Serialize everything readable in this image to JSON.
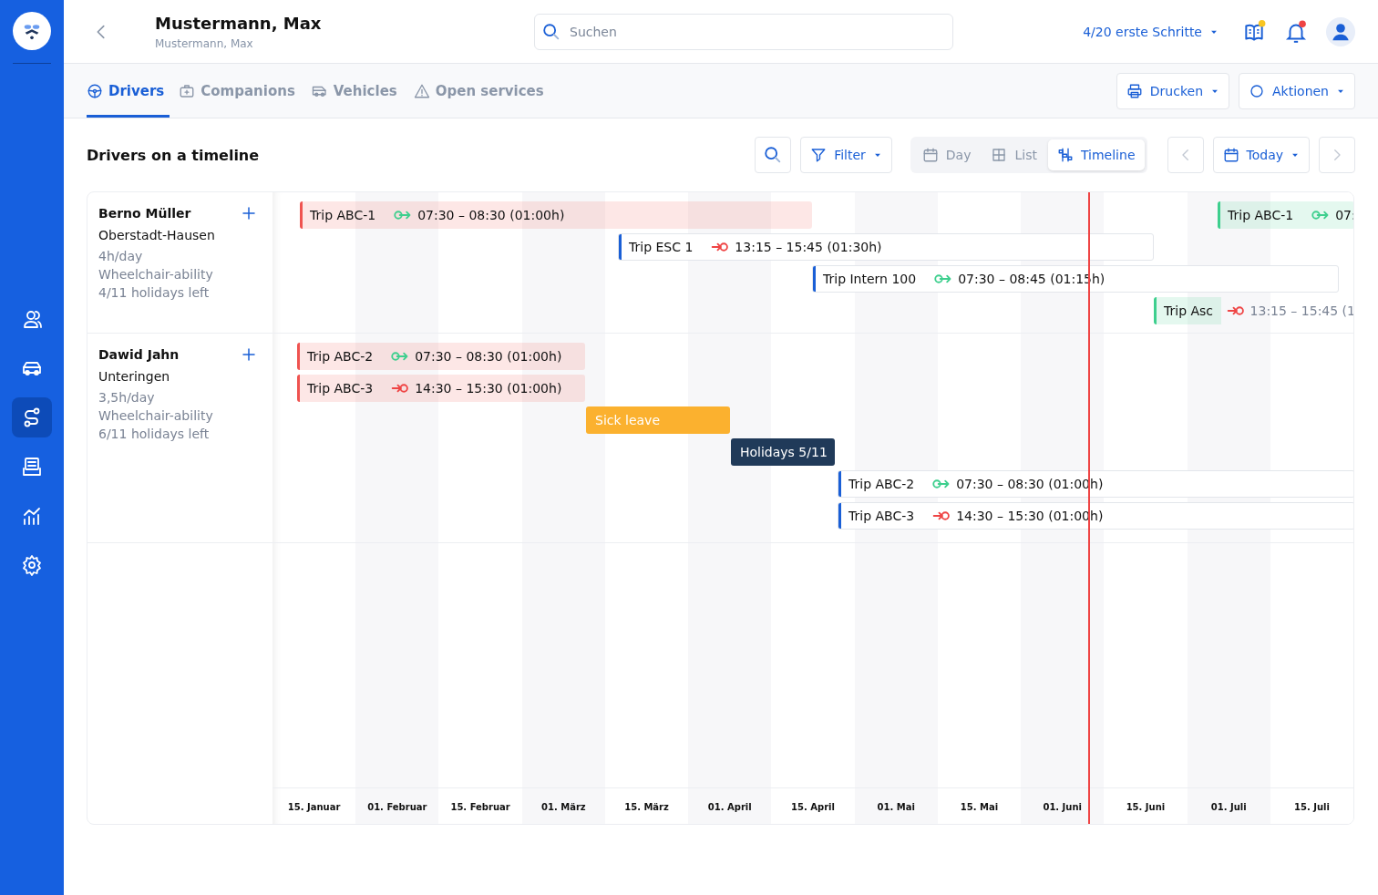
{
  "sidebar": {
    "items": [
      {
        "kind": "people",
        "selected": false
      },
      {
        "kind": "car",
        "selected": false
      },
      {
        "kind": "route",
        "selected": true
      },
      {
        "kind": "inbox",
        "selected": false
      },
      {
        "kind": "stats",
        "selected": false
      },
      {
        "kind": "settings",
        "selected": false
      }
    ]
  },
  "header": {
    "title": "Mustermann, Max",
    "subtitle": "Mustermann, Max",
    "search": {
      "placeholder": "Suchen"
    },
    "onboarding": "4/20 erste Schritte"
  },
  "tabs": [
    {
      "label": "Drivers",
      "kind": "steering",
      "selected": true
    },
    {
      "label": "Companions",
      "kind": "medkit",
      "selected": false
    },
    {
      "label": "Vehicles",
      "kind": "van",
      "selected": false
    },
    {
      "label": "Open services",
      "kind": "warning",
      "selected": false
    }
  ],
  "actions": [
    {
      "label": "Drucken",
      "kind": "printer"
    },
    {
      "label": "Aktionen",
      "kind": "circle"
    }
  ],
  "section_title": "Drivers on a timeline",
  "toolbar": {
    "filter": "Filter",
    "views": [
      {
        "label": "Day",
        "kind": "calendar",
        "selected": false
      },
      {
        "label": "List",
        "kind": "grid",
        "selected": false
      },
      {
        "label": "Timeline",
        "kind": "timeline",
        "selected": true
      }
    ],
    "today": "Today"
  },
  "drivers": [
    {
      "name": "Berno Müller",
      "city": "Oberstadt-Hausen",
      "details": [
        "4h/day",
        "Wheelchair-ability",
        "4/11 holidays left"
      ],
      "bars": [
        {
          "kind": "trip",
          "title": "Trip ABC-1",
          "color": "#ef5350",
          "filled": true,
          "outbound": true,
          "time": "07:30 – 08:30 (01:00h)"
        },
        {
          "kind": "trip",
          "title": "Trip ABC-1",
          "color": "#3ecf8e",
          "filled": true,
          "outbound": true,
          "time": "07:"
        },
        {
          "kind": "trip",
          "title": "Trip ESC 1",
          "color": "#1a5fd6",
          "filled": false,
          "outbound": false,
          "time": "13:15 – 15:45 (01:30h)"
        },
        {
          "kind": "trip",
          "title": "Trip Intern 100",
          "color": "#1a5fd6",
          "filled": false,
          "outbound": true,
          "time": "07:30 – 08:45 (01:15h)"
        },
        {
          "kind": "trip",
          "title": "Trip Asc",
          "color": "#3ecf8e",
          "filled": true,
          "outbound": false,
          "time": "13:15 – 15:45 (1"
        }
      ]
    },
    {
      "name": "Dawid Jahn",
      "city": "Unteringen",
      "details": [
        "3,5h/day",
        "Wheelchair-ability",
        "6/11 holidays left"
      ],
      "bars": [
        {
          "kind": "trip",
          "title": "Trip ABC-2",
          "color": "#ef5350",
          "filled": true,
          "outbound": true,
          "time": "07:30 – 08:30 (01:00h)"
        },
        {
          "kind": "trip",
          "title": "Trip ABC-3",
          "color": "#ef5350",
          "filled": true,
          "outbound": false,
          "time": "14:30 – 15:30 (01:00h)"
        },
        {
          "kind": "absence",
          "title": "Sick leave",
          "color": "#fbb12f"
        },
        {
          "kind": "absence",
          "title": "Holidays 5/11",
          "color": "#203a59"
        },
        {
          "kind": "trip",
          "title": "Trip ABC-2",
          "color": "#1a5fd6",
          "filled": false,
          "outbound": true,
          "time": "07:30 – 08:30 (01:00h)"
        },
        {
          "kind": "trip",
          "title": "Trip ABC-3",
          "color": "#1a5fd6",
          "filled": false,
          "outbound": false,
          "time": "14:30 – 15:30 (01:00h)"
        }
      ]
    }
  ],
  "axis": [
    "15. Januar",
    "01. Februar",
    "15. Februar",
    "01. März",
    "15. März",
    "01. April",
    "15. April",
    "01. Mai",
    "15. Mai",
    "01. Juni",
    "15. Juni",
    "01. Juli",
    "15. Juli"
  ]
}
